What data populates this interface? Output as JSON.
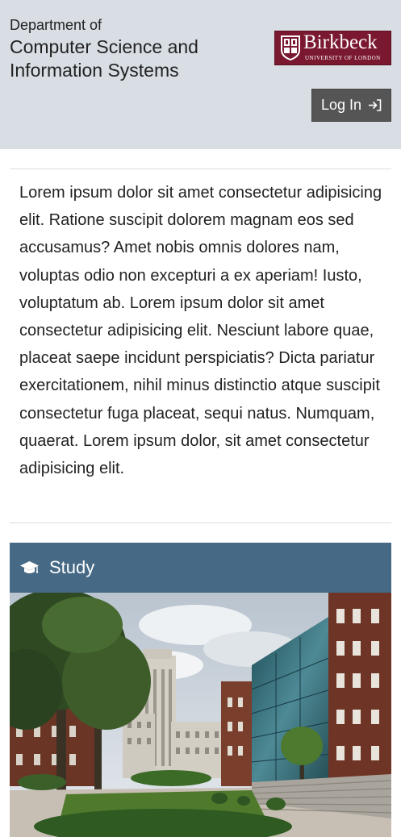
{
  "header": {
    "dept_prefix": "Department of",
    "dept_name": "Computer Science and Information Systems",
    "logo": {
      "brand": "Birkbeck",
      "subtitle": "UNIVERSITY OF LONDON",
      "icon": "crest-icon",
      "color": "#7a1830"
    },
    "login_label": "Log In",
    "login_icon": "sign-in-icon"
  },
  "intro_text": "Lorem ipsum dolor sit amet consectetur adipisicing elit. Ratione suscipit dolorem magnam eos sed accusamus? Amet nobis omnis dolores nam, voluptas odio non excepturi a ex aperiam! Iusto, voluptatum ab. Lorem ipsum dolor sit amet consectetur adipisicing elit. Nesciunt labore quae, placeat saepe incidunt perspiciatis? Dicta pariatur exercitationem, nihil minus distinctio atque suscipit consectetur fuga placeat, sequi natus. Numquam, quaerat. Lorem ipsum dolor, sit amet consectetur adipisicing elit.",
  "study": {
    "label": "Study",
    "icon": "graduation-cap-icon",
    "color": "#466985"
  },
  "colors": {
    "header_bg": "#d8dee4",
    "button_bg": "#555555"
  }
}
